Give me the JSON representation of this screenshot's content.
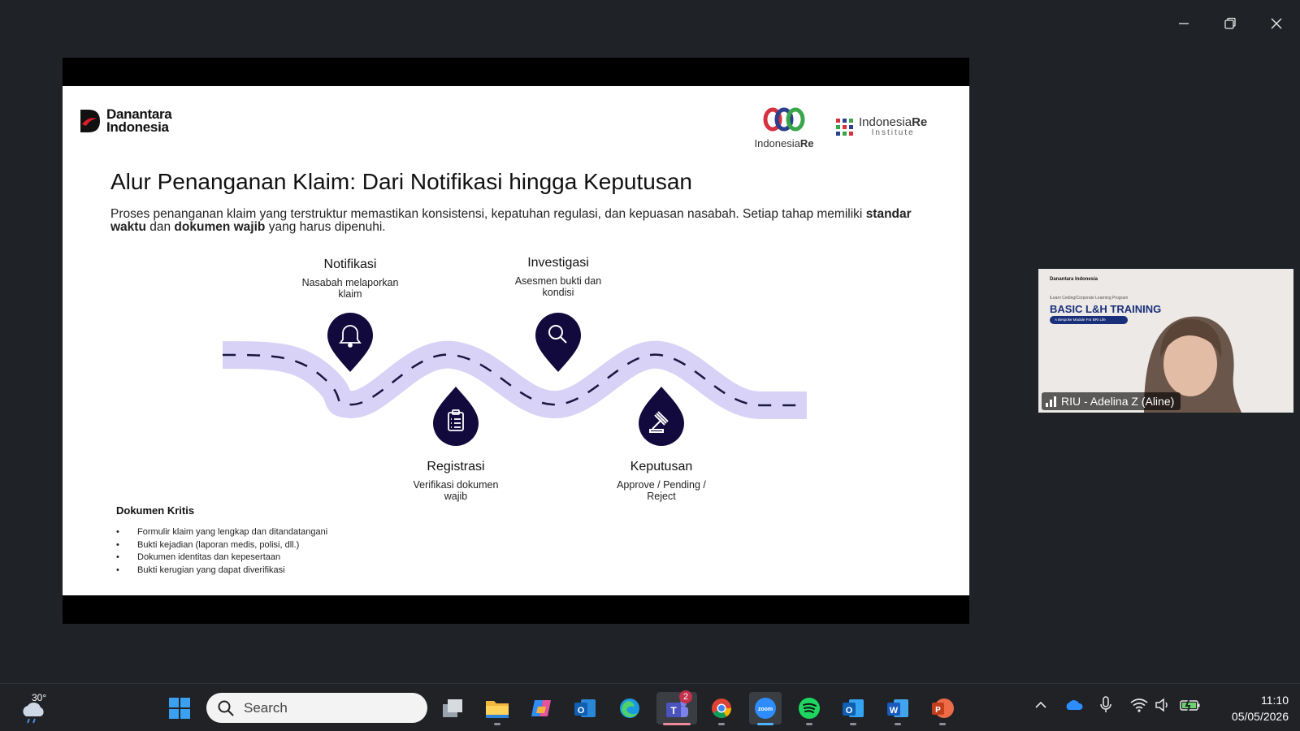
{
  "window_controls": {
    "minimize": "minimize-icon",
    "restore": "restore-icon",
    "close": "close-icon"
  },
  "slide": {
    "logo_left": {
      "line1": "Danantara",
      "line2": "Indonesia"
    },
    "logo_ire": {
      "word_regular": "Indonesia",
      "word_bold": "Re"
    },
    "logo_iri": {
      "word_regular": "Indonesia",
      "word_bold": "Re",
      "sub": "Institute"
    },
    "title": "Alur Penanganan Klaim: Dari Notifikasi hingga Keputusan",
    "intro": {
      "part1": "Proses penanganan klaim yang terstruktur memastikan konsistensi, kepatuhan regulasi, dan kepuasan nasabah. Setiap tahap memiliki ",
      "bold1": "standar waktu",
      "part2": " dan ",
      "bold2": "dokumen wajib",
      "part3": " yang harus dipenuhi."
    },
    "stages": [
      {
        "title": "Notifikasi",
        "desc": "Nasabah melaporkan klaim",
        "icon": "bell-icon"
      },
      {
        "title": "Registrasi",
        "desc": "Verifikasi dokumen wajib",
        "icon": "clipboard-icon"
      },
      {
        "title": "Investigasi",
        "desc": "Asesmen bukti dan kondisi",
        "icon": "magnifier-icon"
      },
      {
        "title": "Keputusan",
        "desc": "Approve / Pending / Reject",
        "icon": "gavel-icon"
      }
    ],
    "docs": {
      "heading": "Dokumen Kritis",
      "items": [
        "Formulir klaim yang lengkap dan ditandatangani",
        "Bukti kejadian (laporan medis, polisi, dll.)",
        "Dokumen identitas dan kepesertaan",
        "Bukti kerugian yang dapat diverifikasi"
      ]
    },
    "colors": {
      "road": "#d8d2f7",
      "marker": "#120a3d",
      "dash": "#1b1640"
    }
  },
  "video": {
    "participant_name": "RIU - Adelina Z (Aline)",
    "bg_small": "iLearn Ceding/Corporate Learning Program",
    "bg_title": "BASIC L&H TRAINING",
    "bg_pill": "A Bespoke Module For BRI Life",
    "bg_logo": "Danantara Indonesia"
  },
  "taskbar": {
    "weather_temp": "30°",
    "search_placeholder": "Search",
    "teams_badge": "2",
    "time": "11:10",
    "date": "05/05/2026"
  }
}
